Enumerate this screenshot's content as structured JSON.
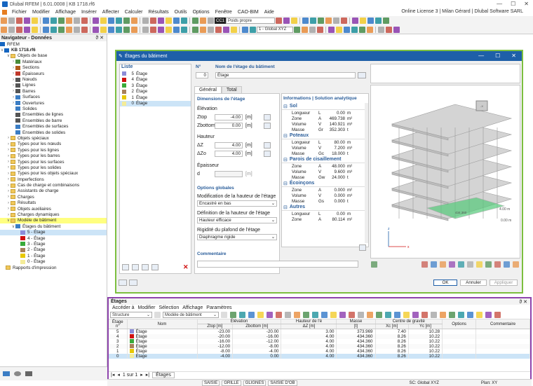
{
  "app": {
    "title": "Dlubal RFEM | 6.01.0008 | KB 1718.rf6",
    "license": "Online License 3 | Milan Gérard | Dlubal Software SARL"
  },
  "menu": [
    "Fichier",
    "Modifier",
    "Affichage",
    "Insérer",
    "Affecter",
    "Calculer",
    "Résultats",
    "Outils",
    "Options",
    "Fenêtre",
    "CAO-BIM",
    "Aide"
  ],
  "toolbar": {
    "cc_badge": "CC1",
    "cc_label": "Poids propre",
    "view_label": "1 - Global XYZ"
  },
  "navigator": {
    "title": "Navigateur - Données",
    "root": "RFEM",
    "file": "KB 1718.rf6",
    "items": [
      {
        "label": "Objets de base",
        "level": 1,
        "exp": "v",
        "icon": "folder"
      },
      {
        "label": "Matériaux",
        "level": 2,
        "exp": ">",
        "icon": "material"
      },
      {
        "label": "Sections",
        "level": 2,
        "exp": ">",
        "icon": "section"
      },
      {
        "label": "Épaisseurs",
        "level": 2,
        "exp": ">",
        "icon": "thickness"
      },
      {
        "label": "Nœuds",
        "level": 2,
        "exp": ">",
        "icon": "node"
      },
      {
        "label": "Lignes",
        "level": 2,
        "exp": ">",
        "icon": "line"
      },
      {
        "label": "Barres",
        "level": 2,
        "exp": ">",
        "icon": "member"
      },
      {
        "label": "Surfaces",
        "level": 2,
        "exp": ">",
        "icon": "surface"
      },
      {
        "label": "Ouvertures",
        "level": 2,
        "exp": ">",
        "icon": "opening"
      },
      {
        "label": "Solides",
        "level": 2,
        "exp": "",
        "icon": "solid"
      },
      {
        "label": "Ensembles de lignes",
        "level": 2,
        "exp": "",
        "icon": "lineset"
      },
      {
        "label": "Ensembles de barre",
        "level": 2,
        "exp": "",
        "icon": "memberset"
      },
      {
        "label": "Ensembles de surfaces",
        "level": 2,
        "exp": "",
        "icon": "surfaceset"
      },
      {
        "label": "Ensembles de solides",
        "level": 2,
        "exp": "",
        "icon": "solidset"
      },
      {
        "label": "Objets spéciaux",
        "level": 1,
        "exp": ">",
        "icon": "folder"
      },
      {
        "label": "Types pour les nœuds",
        "level": 1,
        "exp": ">",
        "icon": "folder"
      },
      {
        "label": "Types pour les lignes",
        "level": 1,
        "exp": ">",
        "icon": "folder"
      },
      {
        "label": "Types pour les barres",
        "level": 1,
        "exp": ">",
        "icon": "folder"
      },
      {
        "label": "Types pour les surfaces",
        "level": 1,
        "exp": ">",
        "icon": "folder"
      },
      {
        "label": "Types pour les solides",
        "level": 1,
        "exp": ">",
        "icon": "folder"
      },
      {
        "label": "Types pour les objets spéciaux",
        "level": 1,
        "exp": ">",
        "icon": "folder"
      },
      {
        "label": "Imperfections",
        "level": 1,
        "exp": ">",
        "icon": "folder"
      },
      {
        "label": "Cas de charge et combinaisons",
        "level": 1,
        "exp": ">",
        "icon": "folder"
      },
      {
        "label": "Assistants de charge",
        "level": 1,
        "exp": ">",
        "icon": "folder"
      },
      {
        "label": "Charges",
        "level": 1,
        "exp": ">",
        "icon": "folder"
      },
      {
        "label": "Résultats",
        "level": 1,
        "exp": ">",
        "icon": "folder"
      },
      {
        "label": "Objets auxiliaires",
        "level": 1,
        "exp": ">",
        "icon": "folder"
      },
      {
        "label": "Charges dynamiques",
        "level": 1,
        "exp": ">",
        "icon": "folder"
      },
      {
        "label": "Modèle de bâtiment",
        "level": 1,
        "exp": "v",
        "icon": "folder",
        "hl": true
      },
      {
        "label": "Étages du bâtiment",
        "level": 2,
        "exp": "v",
        "icon": "storey"
      },
      {
        "label": "5 - Étage",
        "level": 3,
        "exp": "",
        "icon": "c5",
        "sel": true
      },
      {
        "label": "4 - Étage",
        "level": 3,
        "exp": "",
        "icon": "c4"
      },
      {
        "label": "3 - Étage",
        "level": 3,
        "exp": "",
        "icon": "c3"
      },
      {
        "label": "2 - Étage",
        "level": 3,
        "exp": "",
        "icon": "c2"
      },
      {
        "label": "1 - Étage",
        "level": 3,
        "exp": "",
        "icon": "c1"
      },
      {
        "label": "0 - Étage",
        "level": 3,
        "exp": "",
        "icon": "c0"
      },
      {
        "label": "Rapports d'impression",
        "level": 0,
        "exp": "",
        "icon": "folder"
      }
    ]
  },
  "colors": {
    "c5": "#8c8cd8",
    "c4": "#d01010",
    "c3": "#3aaa3a",
    "c2": "#a8805a",
    "c1": "#e8c800",
    "c0": "#f4ec98",
    "accent": "#1e5fa8",
    "green_frame": "#7cbf3f",
    "purple_frame": "#8e44ad"
  },
  "dialog": {
    "title": "Étages du bâtiment",
    "list_header": "Liste",
    "list": [
      {
        "no": "5",
        "name": "Étage",
        "c": "c5"
      },
      {
        "no": "4",
        "name": "Étage",
        "c": "c4"
      },
      {
        "no": "3",
        "name": "Étage",
        "c": "c3"
      },
      {
        "no": "2",
        "name": "Étage",
        "c": "c2"
      },
      {
        "no": "1",
        "name": "Étage",
        "c": "c1"
      },
      {
        "no": "0",
        "name": "Étage",
        "c": "c0",
        "sel": true
      }
    ],
    "no_label": "N°",
    "no_value": "0",
    "name_label": "Nom de l'étage du bâtiment",
    "name_value": "Étage",
    "tabs": [
      "Général",
      "Total"
    ],
    "dims_header": "Dimensions de l'étage",
    "elev_label": "Élévation",
    "ztop_label": "Ztop",
    "ztop_value": "-4.00",
    "zbot_label": "Zbottom",
    "zbot_value": "0.00",
    "unit_m": "[m]",
    "height_label": "Hauteur",
    "dz_label": "ΔZ",
    "dz_value": "4.00",
    "dzo_label": "ΔZo",
    "dzo_value": "4.00",
    "thick_label": "Épaisseur",
    "d_label": "d",
    "global_header": "Options globales",
    "modif_label": "Modification de la hauteur de l'étage",
    "modif_value": "Encastré en bas",
    "def_label": "Définition de la hauteur de l'étage",
    "def_value": "Hauteur efficace",
    "rig_label": "Rigidité du plafond de l'étage",
    "rig_value": "Diaphragme rigide",
    "comment_label": "Commentaire",
    "info_header": "Informations | Solution analytique",
    "info": [
      {
        "t": "Sol",
        "rows": [
          [
            "Longueur",
            "L",
            "0.00",
            "m"
          ],
          [
            "Zone",
            "A",
            "469.738",
            "m²"
          ],
          [
            "Volume",
            "V",
            "140.921",
            "m³"
          ],
          [
            "Masse",
            "Gr",
            "352.303",
            "t"
          ]
        ]
      },
      {
        "t": "Poteaux",
        "rows": [
          [
            "Longueur",
            "L",
            "80.00",
            "m"
          ],
          [
            "Volume",
            "V",
            "7.200",
            "m³"
          ],
          [
            "Masse",
            "Gc",
            "18.000",
            "t"
          ]
        ]
      },
      {
        "t": "Parois de cisaillement",
        "rows": [
          [
            "Zone",
            "A",
            "48.000",
            "m²"
          ],
          [
            "Volume",
            "V",
            "9.600",
            "m³"
          ],
          [
            "Masse",
            "Gw",
            "24.000",
            "t"
          ]
        ]
      },
      {
        "t": "Écoinçons",
        "rows": [
          [
            "Zone",
            "A",
            "0.000",
            "m²"
          ],
          [
            "Volume",
            "V",
            "0.000",
            "m³"
          ],
          [
            "Masse",
            "Gs",
            "0.000",
            "t"
          ]
        ]
      },
      {
        "t": "Autres",
        "rows": [
          [
            "Longueur",
            "L",
            "0.00",
            "m"
          ],
          [
            "Zone",
            "A",
            "80.114",
            "m²"
          ]
        ]
      }
    ],
    "dim_a": "4.00 m",
    "dim_b": "434.360",
    "dim_c": "0.00 m",
    "axis_z": "z",
    "axis_x": "x",
    "ok": "OK",
    "cancel": "Annuler",
    "apply": "Appliquer"
  },
  "table_panel": {
    "title": "Étages",
    "menu": [
      "Accéder à",
      "Modifier",
      "Sélection",
      "Affichage",
      "Paramètres"
    ],
    "struct_label": "Structure",
    "model_label": "Modèle de bâtiment",
    "h": {
      "no": "Étage n°",
      "name": "Nom",
      "elev": "Élévation",
      "ztop": "Ztop [m]",
      "zbot": "Zbottom [m]",
      "hgt": "Hauteur de l'é",
      "dz": "ΔZ [m]",
      "mass": "Masse",
      "mass_u": "[t]",
      "cg": "Centre de gravité",
      "xc": "Xc [m]",
      "yc": "Yc [m]",
      "opt": "Options",
      "com": "Commentaire"
    },
    "rows": [
      {
        "no": "5",
        "name": "Étage",
        "c": "c5",
        "ztop": "-23.00",
        "zbot": "-20.00",
        "dz": "3.00",
        "mass": "373.969",
        "xc": "7.40",
        "yc": "10.28"
      },
      {
        "no": "4",
        "name": "Étage",
        "c": "c4",
        "ztop": "-20.00",
        "zbot": "-16.00",
        "dz": "4.00",
        "mass": "434.360",
        "xc": "8.26",
        "yc": "10.22"
      },
      {
        "no": "3",
        "name": "Étage",
        "c": "c3",
        "ztop": "-16.00",
        "zbot": "-12.00",
        "dz": "4.00",
        "mass": "434.360",
        "xc": "8.26",
        "yc": "10.22"
      },
      {
        "no": "2",
        "name": "Étage",
        "c": "c2",
        "ztop": "-12.00",
        "zbot": "-8.00",
        "dz": "4.00",
        "mass": "434.360",
        "xc": "8.26",
        "yc": "10.22"
      },
      {
        "no": "1",
        "name": "Étage",
        "c": "c1",
        "ztop": "-8.00",
        "zbot": "-4.00",
        "dz": "4.00",
        "mass": "434.360",
        "xc": "8.26",
        "yc": "10.22"
      },
      {
        "no": "0",
        "name": "Étage",
        "c": "c0",
        "ztop": "-4.00",
        "zbot": "0.00",
        "dz": "4.00",
        "mass": "434.360",
        "xc": "8.26",
        "yc": "10.22",
        "sel": true
      }
    ],
    "pager": "1 sur 1",
    "tab": "Étages"
  },
  "status": {
    "items": [
      "SAISIE",
      "GRILLE",
      "GLIGNES",
      "SAISIE D'OB"
    ],
    "cs": "SC: Global XYZ",
    "plan": "Plan: XY"
  }
}
